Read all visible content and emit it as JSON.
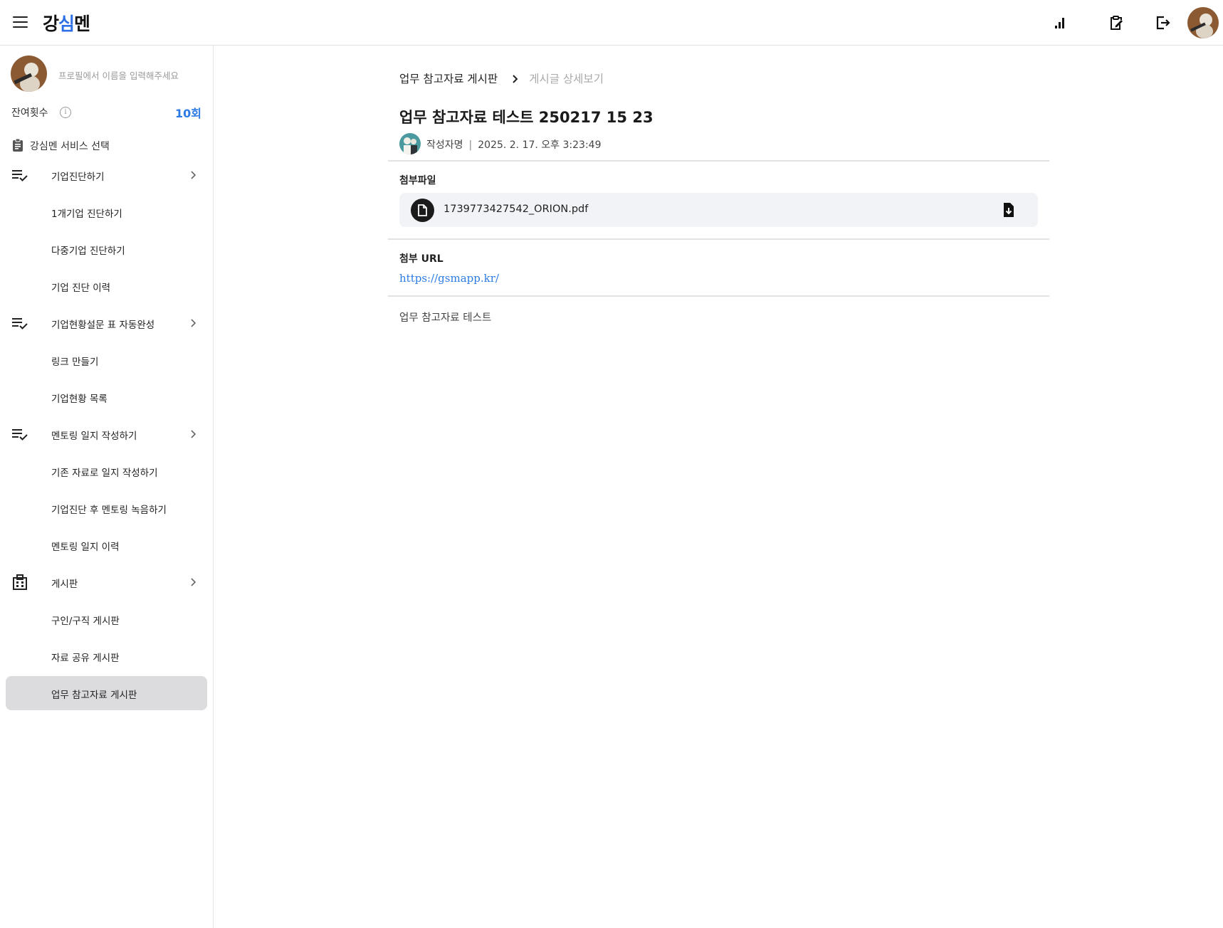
{
  "app": {
    "logo_prefix": "강",
    "logo_ai": "심",
    "logo_suffix": "멘"
  },
  "topbar": {
    "icons": [
      "bar-chart-icon",
      "clipboard-edit-icon",
      "logout-icon"
    ]
  },
  "profile": {
    "name_placeholder": "프로필에서 이름을 입력해주세요",
    "remaining_label": "잔여횟수",
    "remaining_count": "10회"
  },
  "sidebar": {
    "service_title": "강심멘 서비스 선택",
    "groups": [
      {
        "label": "기업진단하기",
        "icon": "checklist-icon",
        "children": [
          "1개기업 진단하기",
          "다중기업 진단하기",
          "기업 진단 이력"
        ]
      },
      {
        "label": "기업현황설문 표 자동완성",
        "icon": "checklist-icon",
        "children": [
          "링크 만들기",
          "기업현황 목록"
        ]
      },
      {
        "label": "멘토링 일지 작성하기",
        "icon": "checklist-icon",
        "children": [
          "기존 자료로 일지 작성하기",
          "기업진단 후 멘토링 녹음하기",
          "멘토링 일지 이력"
        ]
      },
      {
        "label": "게시판",
        "icon": "board-icon",
        "children": [
          "구인/구직 게시판",
          "자료 공유 게시판",
          "업무 참고자료 게시판"
        ]
      }
    ],
    "active_item": "업무 참고자료 게시판"
  },
  "breadcrumb": {
    "parent": "업무 참고자료 게시판",
    "current": "게시글 상세보기"
  },
  "post": {
    "title": "업무 참고자료 테스트 250217 15 23",
    "author": "작성자명",
    "separator": "|",
    "datetime": "2025. 2. 17. 오후 3:23:49",
    "attachment_label": "첨부파일",
    "attachment_filename": "1739773427542_ORION.pdf",
    "url_label": "첨부 URL",
    "url": "https://gsmapp.kr/",
    "body": "업무 참고자료 테스트"
  }
}
